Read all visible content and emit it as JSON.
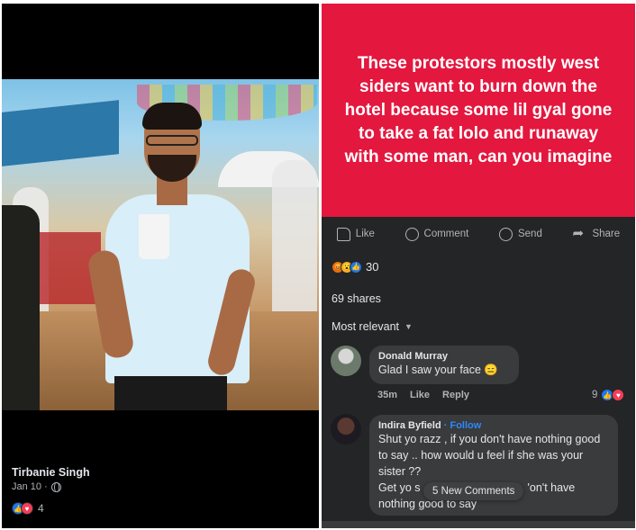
{
  "left_post": {
    "poster_name": "Tirbanie Singh",
    "date": "Jan 10 ·",
    "reaction_count": "4",
    "reactions": [
      "like",
      "love"
    ]
  },
  "right_post": {
    "banner_text": "These protestors mostly west siders want to burn down the hotel because some lil gyal gone to take a fat lolo and runaway with some man, can you imagine",
    "banner_color": "#e4173e",
    "actions": {
      "like": "Like",
      "comment": "Comment",
      "send": "Send",
      "share": "Share"
    },
    "reaction_count": "30",
    "reactions": [
      "angry",
      "wow",
      "like"
    ],
    "shares": "69 shares",
    "sort_label": "Most relevant",
    "comments": [
      {
        "name": "Donald Murray",
        "text": "Glad I saw your face 😑",
        "time": "35m",
        "like": "Like",
        "reply": "Reply",
        "reaction_count": "9"
      },
      {
        "name": "Indira Byfield",
        "follow": "· Follow",
        "text": "Shut yo razz , if you don't have nothing good to say .. how would u feel if she was your sister ??",
        "text_cont_a": "Get yo s",
        "text_cont_b": "'on't have",
        "text_cont_c": "nothing good to say"
      }
    ],
    "new_comments_pill": "5 New Comments"
  }
}
